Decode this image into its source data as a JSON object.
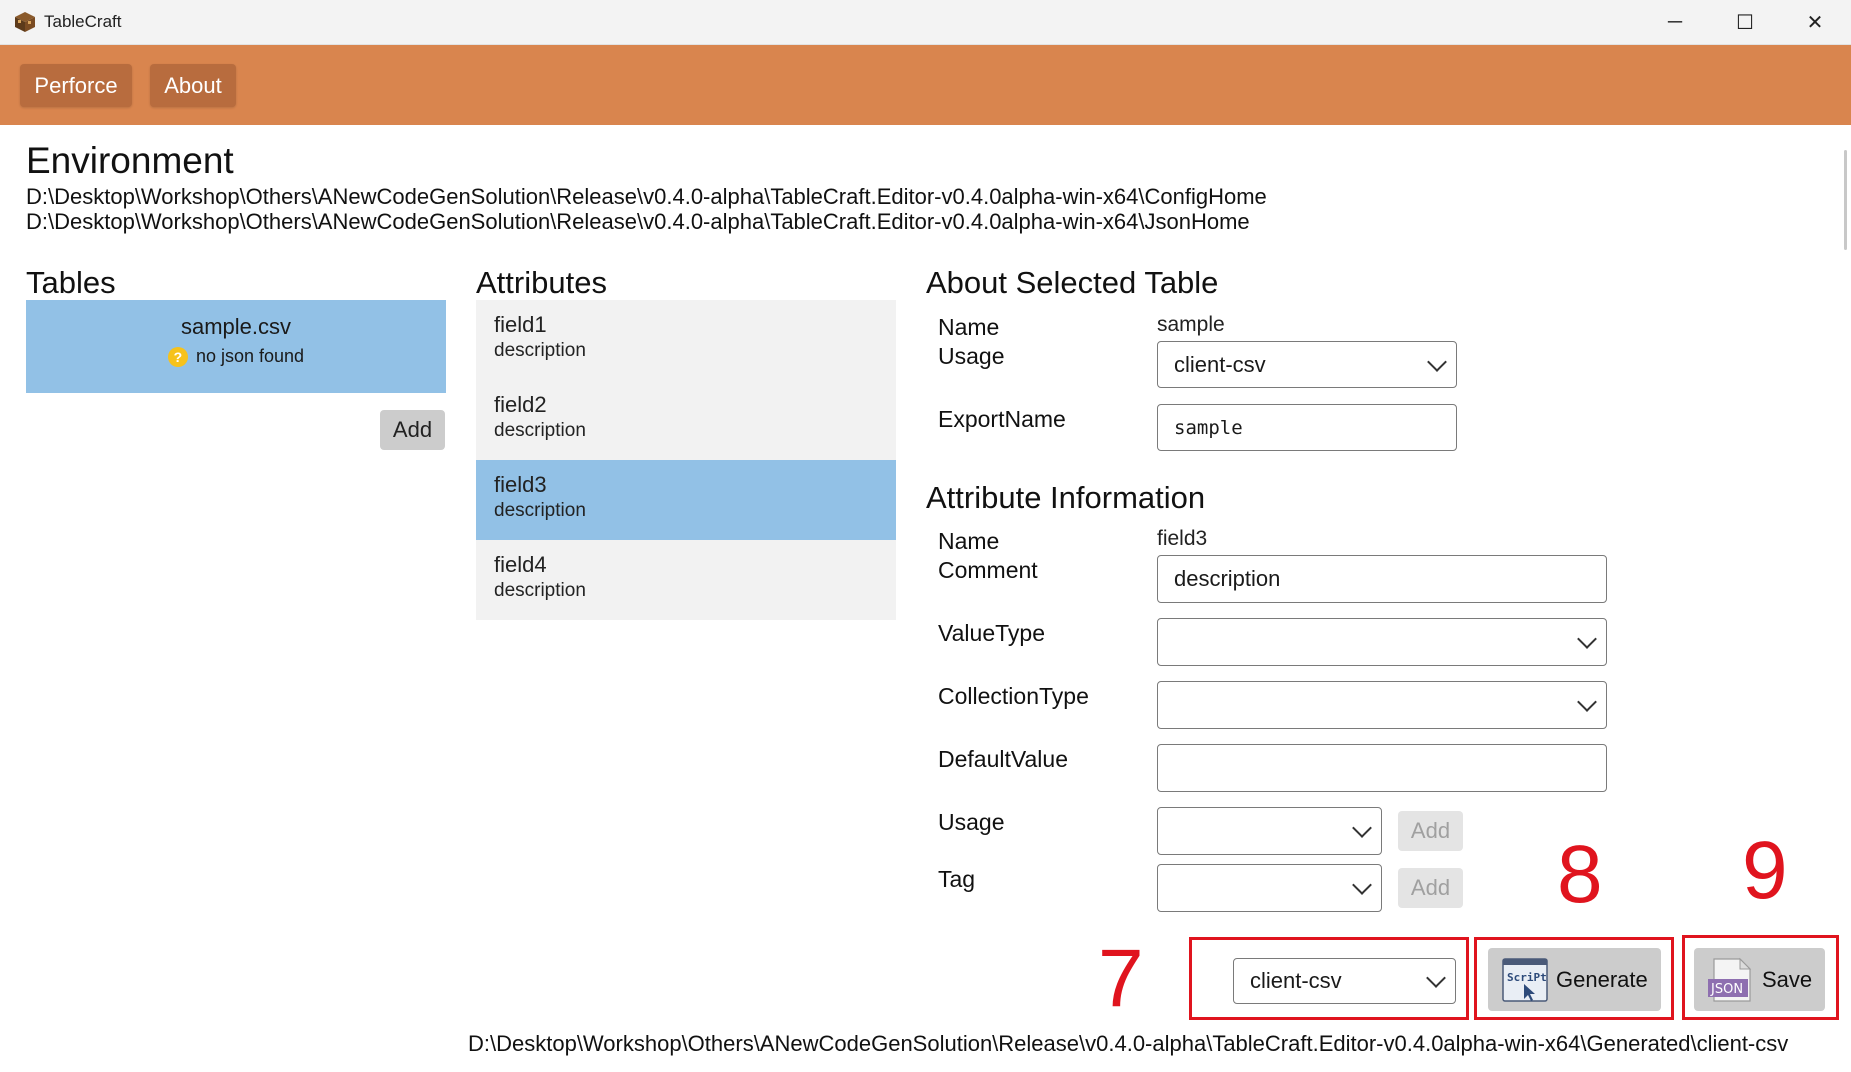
{
  "window": {
    "title": "TableCraft",
    "minimize": "─",
    "maximize": "☐",
    "close": "✕"
  },
  "toolbar": {
    "perforce": "Perforce",
    "about": "About"
  },
  "environment": {
    "title": "Environment",
    "config_path": "D:\\Desktop\\Workshop\\Others\\ANewCodeGenSolution\\Release\\v0.4.0-alpha\\TableCraft.Editor-v0.4.0alpha-win-x64\\ConfigHome",
    "json_path": "D:\\Desktop\\Workshop\\Others\\ANewCodeGenSolution\\Release\\v0.4.0-alpha\\TableCraft.Editor-v0.4.0alpha-win-x64\\JsonHome"
  },
  "tables": {
    "title": "Tables",
    "items": [
      {
        "name": "sample.csv",
        "status": "no json found",
        "status_icon": "question-warning-icon"
      }
    ],
    "add_label": "Add"
  },
  "attributes": {
    "title": "Attributes",
    "items": [
      {
        "name": "field1",
        "description": "description",
        "selected": false
      },
      {
        "name": "field2",
        "description": "description",
        "selected": false
      },
      {
        "name": "field3",
        "description": "description",
        "selected": true
      },
      {
        "name": "field4",
        "description": "description",
        "selected": false
      }
    ]
  },
  "selected_table": {
    "title": "About Selected Table",
    "name_label": "Name",
    "name_value": "sample",
    "usage_label": "Usage",
    "usage_value": "client-csv",
    "export_label": "ExportName",
    "export_value": "sample"
  },
  "attribute_info": {
    "title": "Attribute Information",
    "name_label": "Name",
    "name_value": "field3",
    "comment_label": "Comment",
    "comment_value": "description",
    "valuetype_label": "ValueType",
    "valuetype_value": "",
    "collectiontype_label": "CollectionType",
    "collectiontype_value": "",
    "defaultvalue_label": "DefaultValue",
    "defaultvalue_value": "",
    "usage_label": "Usage",
    "usage_value": "",
    "usage_add": "Add",
    "tag_label": "Tag",
    "tag_value": "",
    "tag_add": "Add"
  },
  "actions": {
    "target_value": "client-csv",
    "generate_label": "Generate",
    "generate_icon": "script-icon",
    "generate_icon_text": "ScriPt",
    "save_label": "Save",
    "save_icon": "json-file-icon",
    "save_icon_text": "JSON",
    "output_path": "D:\\Desktop\\Workshop\\Others\\ANewCodeGenSolution\\Release\\v0.4.0-alpha\\TableCraft.Editor-v0.4.0alpha-win-x64\\Generated\\client-csv"
  },
  "annotations": {
    "seven": "7",
    "eight": "8",
    "nine": "9",
    "color": "#e0141e"
  },
  "theme": {
    "toolbar_color": "#d9854e",
    "toolbar_button_color": "#b86c3e",
    "selection_color": "#92c1e6"
  }
}
